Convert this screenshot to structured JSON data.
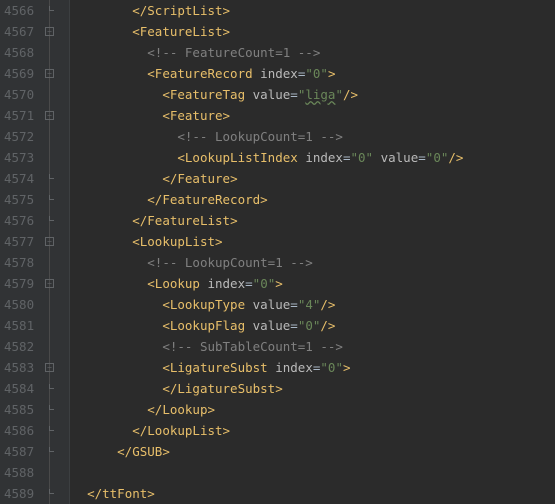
{
  "lines": [
    {
      "num": "4566",
      "indent": 4,
      "kind": "close",
      "tag": "ScriptList"
    },
    {
      "num": "4567",
      "indent": 4,
      "kind": "open",
      "tag": "FeatureList"
    },
    {
      "num": "4568",
      "indent": 5,
      "kind": "comment",
      "text": "FeatureCount=1"
    },
    {
      "num": "4569",
      "indent": 5,
      "kind": "open",
      "tag": "FeatureRecord",
      "attrs": [
        {
          "n": "index",
          "v": "0"
        }
      ]
    },
    {
      "num": "4570",
      "indent": 6,
      "kind": "self",
      "tag": "FeatureTag",
      "attrs": [
        {
          "n": "value",
          "v": "liga",
          "liga": true
        }
      ]
    },
    {
      "num": "4571",
      "indent": 6,
      "kind": "open",
      "tag": "Feature"
    },
    {
      "num": "4572",
      "indent": 7,
      "kind": "comment",
      "text": "LookupCount=1"
    },
    {
      "num": "4573",
      "indent": 7,
      "kind": "self",
      "tag": "LookupListIndex",
      "attrs": [
        {
          "n": "index",
          "v": "0"
        },
        {
          "n": "value",
          "v": "0"
        }
      ]
    },
    {
      "num": "4574",
      "indent": 6,
      "kind": "close",
      "tag": "Feature"
    },
    {
      "num": "4575",
      "indent": 5,
      "kind": "close",
      "tag": "FeatureRecord"
    },
    {
      "num": "4576",
      "indent": 4,
      "kind": "close",
      "tag": "FeatureList"
    },
    {
      "num": "4577",
      "indent": 4,
      "kind": "open",
      "tag": "LookupList"
    },
    {
      "num": "4578",
      "indent": 5,
      "kind": "comment",
      "text": "LookupCount=1"
    },
    {
      "num": "4579",
      "indent": 5,
      "kind": "open",
      "tag": "Lookup",
      "attrs": [
        {
          "n": "index",
          "v": "0"
        }
      ]
    },
    {
      "num": "4580",
      "indent": 6,
      "kind": "self",
      "tag": "LookupType",
      "attrs": [
        {
          "n": "value",
          "v": "4"
        }
      ]
    },
    {
      "num": "4581",
      "indent": 6,
      "kind": "self",
      "tag": "LookupFlag",
      "attrs": [
        {
          "n": "value",
          "v": "0"
        }
      ]
    },
    {
      "num": "4582",
      "indent": 6,
      "kind": "comment",
      "text": "SubTableCount=1"
    },
    {
      "num": "4583",
      "indent": 6,
      "kind": "open",
      "tag": "LigatureSubst",
      "attrs": [
        {
          "n": "index",
          "v": "0"
        }
      ]
    },
    {
      "num": "4584",
      "indent": 6,
      "kind": "close",
      "tag": "LigatureSubst"
    },
    {
      "num": "4585",
      "indent": 5,
      "kind": "close",
      "tag": "Lookup"
    },
    {
      "num": "4586",
      "indent": 4,
      "kind": "close",
      "tag": "LookupList"
    },
    {
      "num": "4587",
      "indent": 3,
      "kind": "close",
      "tag": "GSUB"
    },
    {
      "num": "4588",
      "indent": 0,
      "kind": "blank"
    },
    {
      "num": "4589",
      "indent": 1,
      "kind": "close",
      "tag": "ttFont"
    }
  ],
  "fold_marks": {
    "4566": "end",
    "4567": "open",
    "4569": "open",
    "4571": "open",
    "4574": "end",
    "4575": "end",
    "4576": "end",
    "4577": "open",
    "4579": "open",
    "4583": "open",
    "4584": "end",
    "4585": "end",
    "4586": "end",
    "4587": "end",
    "4589": "end"
  }
}
